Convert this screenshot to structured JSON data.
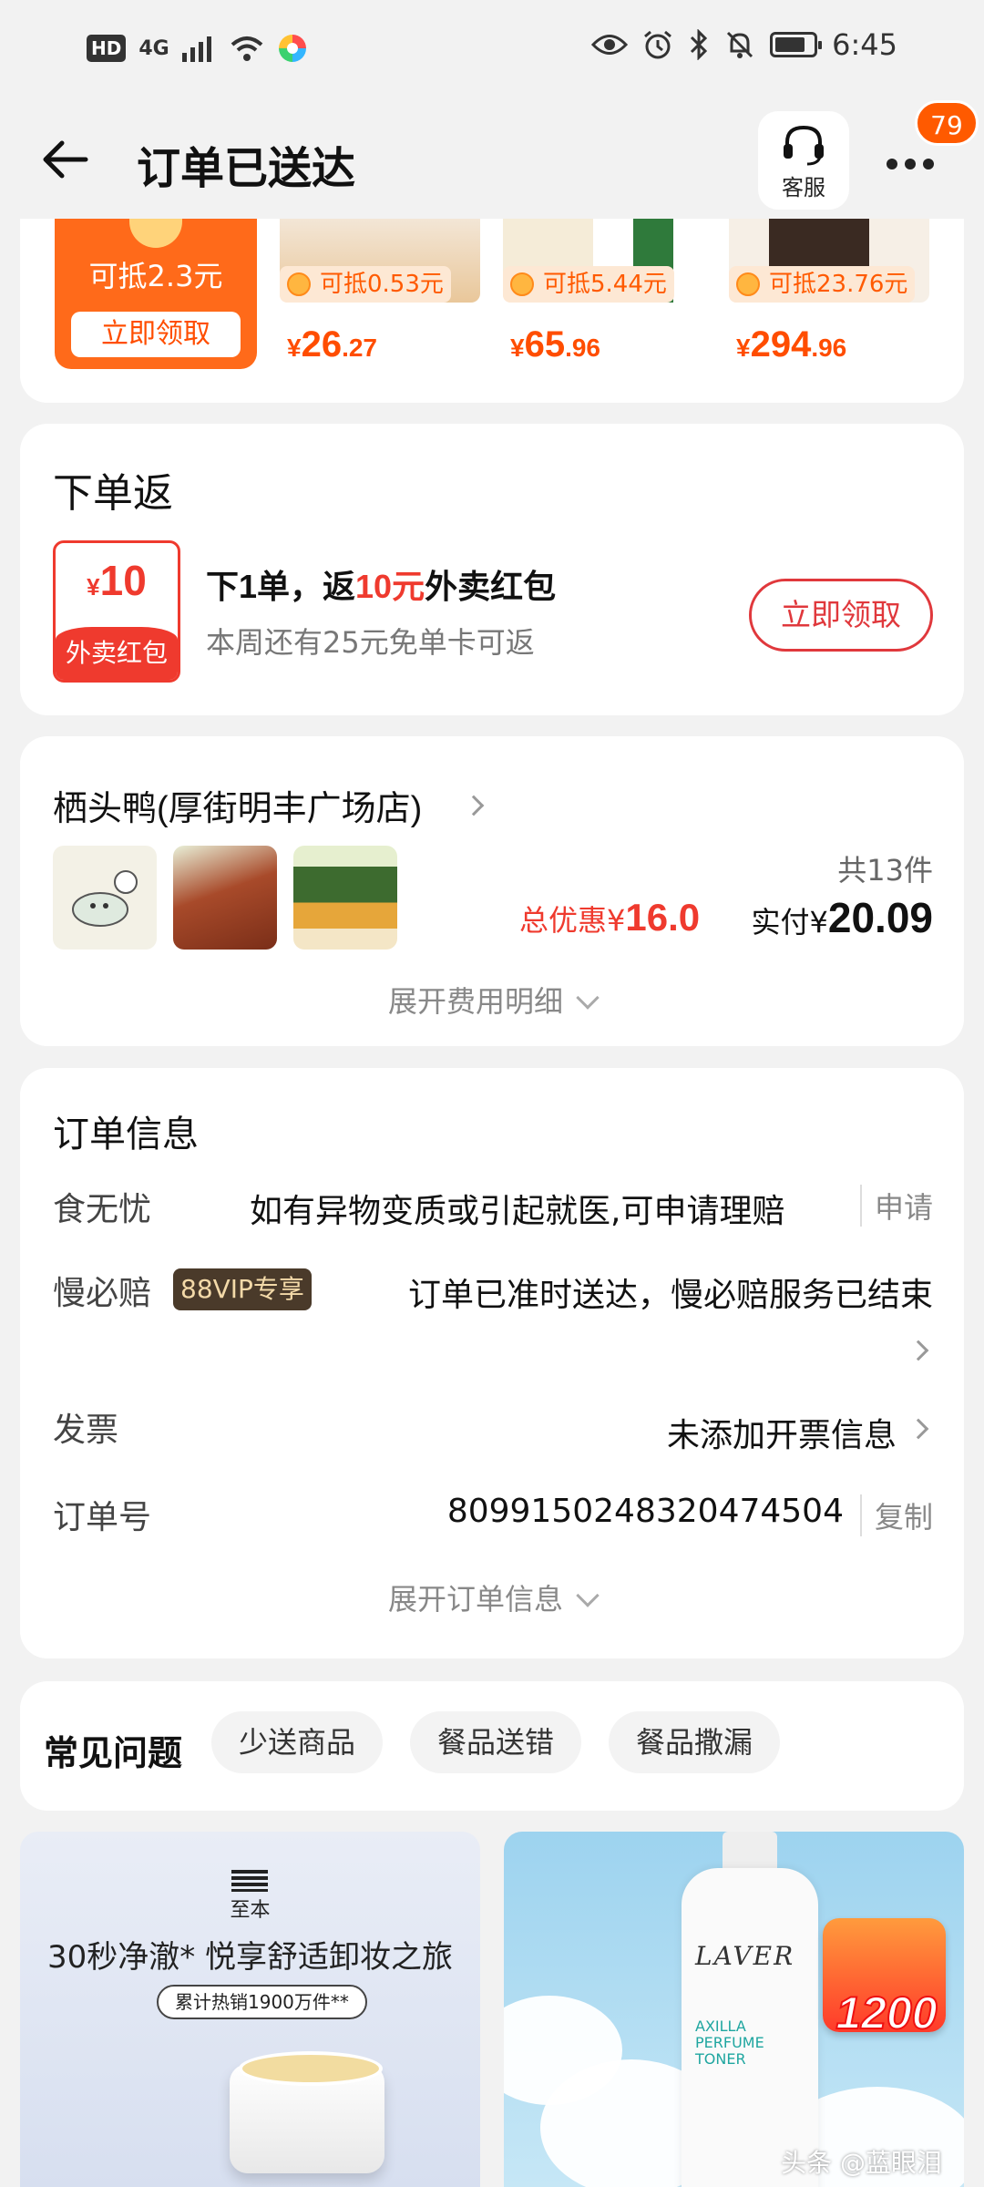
{
  "status_bar": {
    "left_indicators": [
      "HD",
      "4G"
    ],
    "time": "6:45",
    "icons": [
      "eye-icon",
      "alarm-icon",
      "bluetooth-icon",
      "mute-icon",
      "battery-icon"
    ]
  },
  "header": {
    "title": "订单已送达",
    "customer_service_label": "客服",
    "notification_count": "79"
  },
  "coupon_strip": {
    "coupon": {
      "deduct_text": "可抵2.3元",
      "button_label": "立即领取"
    },
    "products": [
      {
        "deal": "可抵0.53元",
        "yen": "¥",
        "price_int": "26",
        "price_dec": ".27"
      },
      {
        "deal": "可抵5.44元",
        "yen": "¥",
        "price_int": "65",
        "price_dec": ".96"
      },
      {
        "deal": "可抵23.76元",
        "yen": "¥",
        "price_int": "294",
        "price_dec": ".96"
      }
    ]
  },
  "order_return": {
    "title": "下单返",
    "packet_currency": "¥",
    "packet_amount": "10",
    "packet_label": "外卖红包",
    "main_prefix": "下1单，返",
    "main_highlight": "10元",
    "main_suffix": "外卖红包",
    "sub": "本周还有25元免单卡可返",
    "button_label": "立即领取"
  },
  "store": {
    "name": "栖头鸭(厚街明丰广场店)",
    "item_count": "共13件",
    "total_discount_label": "总优惠¥",
    "total_discount_value": "16.0",
    "paid_label": "实付¥",
    "paid_value": "20.09",
    "expand_label": "展开费用明细"
  },
  "order_info": {
    "title": "订单信息",
    "rows": [
      {
        "label": "食无忧",
        "value": "如有异物变质或引起就医,可申请理赔",
        "action": "申请"
      },
      {
        "label": "慢必赔",
        "badge": "88VIP专享",
        "value": "订单已准时送达，慢必赔服务已结束"
      },
      {
        "label": "发票",
        "value": "未添加开票信息"
      },
      {
        "label": "订单号",
        "value": "8099150248320474504",
        "action": "复制"
      }
    ],
    "expand_label": "展开订单信息"
  },
  "faq": {
    "title": "常见问题",
    "chips": [
      "少送商品",
      "餐品送错",
      "餐品撒漏"
    ]
  },
  "ads": {
    "left": {
      "brand": "至本",
      "headline": "30秒净澈* 悦享舒适卸妆之旅",
      "pill": "累计热销1900万件**"
    },
    "right": {
      "logo": "LAVER",
      "sub": "AXILLA PERFUME TONER",
      "promo_value": "1200"
    }
  },
  "watermark": "头条 @蓝眼泪",
  "colors": {
    "accent_red": "#ef3a2e",
    "orange": "#ff5a00",
    "badge": "#ff5a00"
  }
}
